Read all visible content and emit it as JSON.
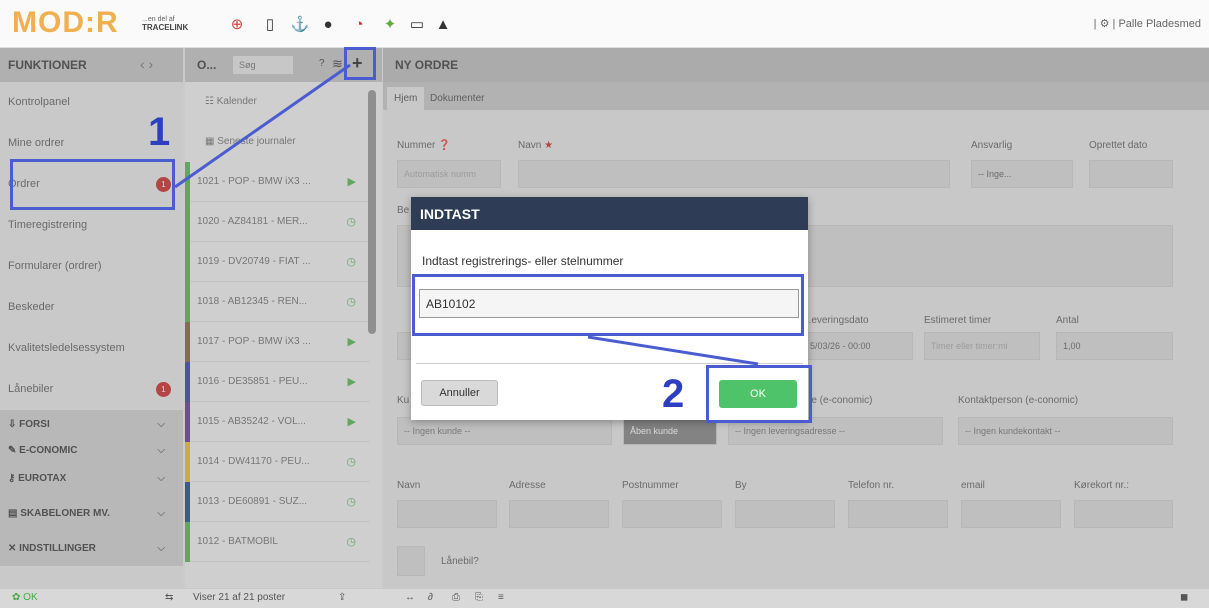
{
  "app": {
    "logo": "MOD:R",
    "logo_sub": "...en del af",
    "logo_brand": "TRACELINK",
    "user_name": "Palle Pladesmed"
  },
  "topbar_icons": [
    "lifebuoy-icon",
    "phone-icon",
    "anchor-icon",
    "chat-icon",
    "notification-icon",
    "sparkle-icon",
    "keyboard-icon",
    "warning-icon"
  ],
  "sidebar": {
    "title": "FUNKTIONER",
    "items": [
      {
        "label": "Kontrolpanel"
      },
      {
        "label": "Mine ordrer"
      },
      {
        "label": "Ordrer",
        "badge": "1"
      },
      {
        "label": "Timeregistrering"
      },
      {
        "label": "Formularer (ordrer)"
      },
      {
        "label": "Beskeder"
      },
      {
        "label": "Kvalitetsledelsessystem"
      },
      {
        "label": "Lånebiler",
        "badge": "1"
      }
    ],
    "sections": [
      {
        "label": "FORSI",
        "icon": "car-lift-icon"
      },
      {
        "label": "E-CONOMIC",
        "icon": "pencil-icon"
      },
      {
        "label": "EUROTAX",
        "icon": "key-icon"
      },
      {
        "label": "SKABELONER MV.",
        "icon": "template-icon"
      },
      {
        "label": "INDSTILLINGER",
        "icon": "tools-icon"
      }
    ]
  },
  "orders": {
    "header": "O...",
    "search_placeholder": "Søg",
    "help": "?",
    "add": "+",
    "calendar": "Kalender",
    "journals": "Seneste journaler",
    "rows": [
      {
        "label": "1021 - POP - BMW iX3 ...",
        "status": "play",
        "color": "#5cb85c"
      },
      {
        "label": "1020 - AZ84181 - MER...",
        "status": "clock",
        "color": "#5cb85c"
      },
      {
        "label": "1019 - DV20749 - FIAT ...",
        "status": "clock",
        "color": "#5cb85c"
      },
      {
        "label": "1018 - AB12345 - REN...",
        "status": "clock",
        "color": "#5cb85c"
      },
      {
        "label": "1017 - POP - BMW iX3 ...",
        "status": "play",
        "color": "#8a6a4a"
      },
      {
        "label": "1016 - DE35851 - PEU...",
        "status": "play",
        "color": "#3b4aa8"
      },
      {
        "label": "1015 - AB35242 - VOL...",
        "status": "play",
        "color": "#6a3fa0"
      },
      {
        "label": "1014 - DW41170 - PEU...",
        "status": "clock",
        "color": "#e3c23a"
      },
      {
        "label": "1013 - DE60891 - SUZ...",
        "status": "clock",
        "color": "#2a4f90"
      },
      {
        "label": "1012 - BATMOBIL",
        "status": "clock",
        "color": "#5cb85c"
      }
    ]
  },
  "main": {
    "title": "NY ORDRE",
    "tabs": [
      "Hjem",
      "Dokumenter"
    ],
    "labels": {
      "nummer": "Nummer",
      "navn": "Navn",
      "ansvarlig": "Ansvarlig",
      "oprettet": "Oprettet dato",
      "leveringsdato": "...everingsdato",
      "estimeret": "Estimeret timer",
      "antal": "Antal",
      "lev_adr": "...e (e-conomic)",
      "kontaktperson": "Kontaktperson (e-conomic)",
      "b_navn": "Navn",
      "adresse": "Adresse",
      "postnummer": "Postnummer",
      "by": "By",
      "telefon": "Telefon nr.",
      "email": "email",
      "korekort": "Kørekort nr.:",
      "lanebil": "Lånebil?",
      "be": "Be",
      "ku": "Ku"
    },
    "values": {
      "nummer_placeholder": "Automatisk numm",
      "ansvarlig": "-- Inge...",
      "leveringsdato": "5/03/26 - 00:00",
      "estimeret_placeholder": "Timer eller timer:mi",
      "antal": "1,00",
      "kunde": "-- Ingen kunde --",
      "aaben_kunde": "Åben kunde",
      "levering": "-- Ingen leveringsadresse --",
      "kontakt": "-- Ingen kundekontakt --"
    }
  },
  "dialog": {
    "title": "INDTAST",
    "prompt": "Indtast registrerings- eller stelnummer",
    "input_value": "AB10102",
    "cancel": "Annuller",
    "ok": "OK"
  },
  "annotations": {
    "step1": "1",
    "step2": "2",
    "color": "#4a5cd0"
  },
  "bottom": {
    "status": "OK",
    "count": "Viser 21 af 21 poster"
  }
}
